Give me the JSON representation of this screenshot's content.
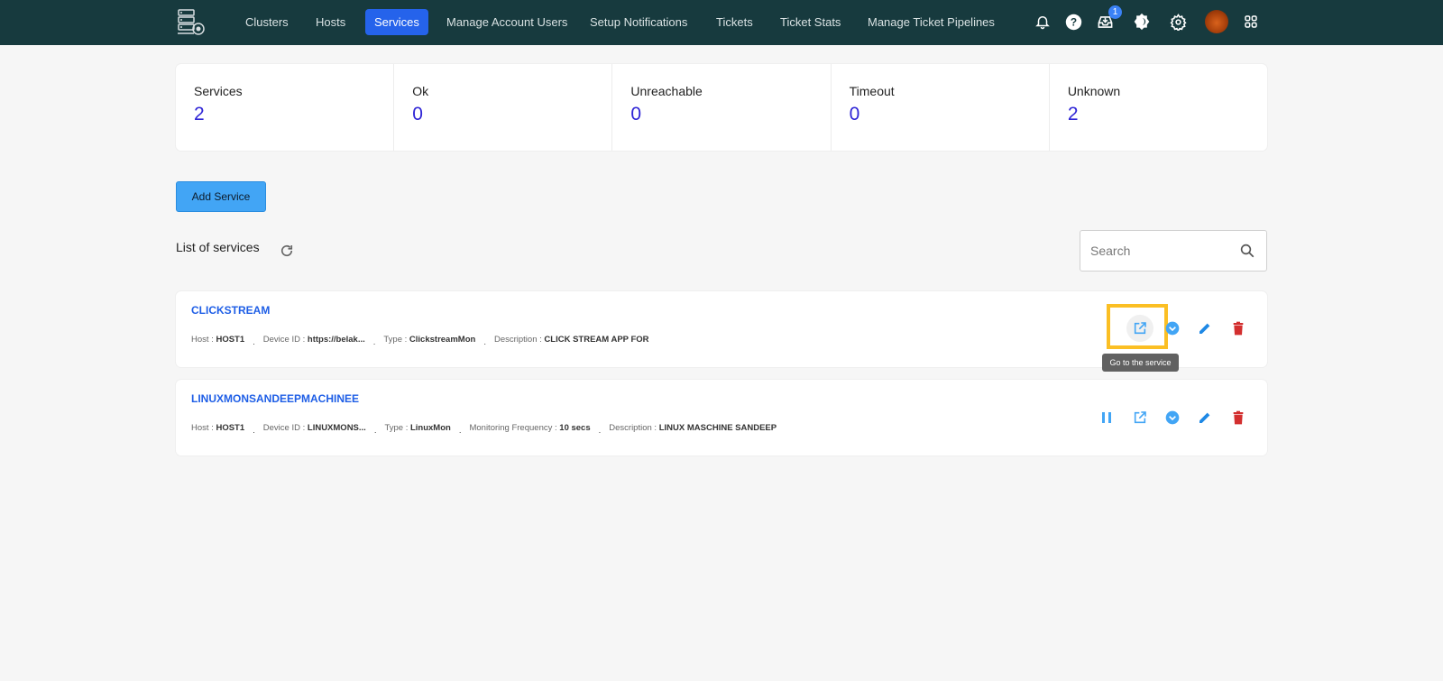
{
  "nav": {
    "items": [
      {
        "label": "Clusters",
        "active": false
      },
      {
        "label": "Hosts",
        "active": false
      },
      {
        "label": "Services",
        "active": true
      },
      {
        "label": "Manage Account Users",
        "active": false
      },
      {
        "label": "Setup Notifications",
        "active": false
      },
      {
        "label": "Tickets",
        "active": false
      },
      {
        "label": "Ticket Stats",
        "active": false
      },
      {
        "label": "Manage Ticket Pipelines",
        "active": false
      }
    ],
    "icons": [
      "bell-icon",
      "help-icon",
      "inbox-icon",
      "theme-toggle-icon",
      "settings-icon",
      "avatar",
      "apps-grid-icon"
    ],
    "inbox_badge": "1",
    "accent_color": "#2563eb",
    "bg_color": "#173a3e"
  },
  "stats": [
    {
      "label": "Services",
      "value": "2"
    },
    {
      "label": "Ok",
      "value": "0"
    },
    {
      "label": "Unreachable",
      "value": "0"
    },
    {
      "label": "Timeout",
      "value": "0"
    },
    {
      "label": "Unknown",
      "value": "2"
    }
  ],
  "add_service_label": "Add Service",
  "list_title": "List of services",
  "search": {
    "placeholder": "Search",
    "value": ""
  },
  "services": [
    {
      "name": "CLICKSTREAM",
      "fields": [
        {
          "label": "Host :",
          "value": "HOST1"
        },
        {
          "label": "Device ID :",
          "value": "https://belak..."
        },
        {
          "label": "Type :",
          "value": "ClickstreamMon"
        },
        {
          "label": "Description :",
          "value": "CLICK STREAM APP FOR"
        }
      ],
      "actions": [
        "open-service",
        "status-toggle",
        "edit",
        "delete"
      ]
    },
    {
      "name": "LINUXMONSANDEEPMACHINEE",
      "fields": [
        {
          "label": "Host :",
          "value": "HOST1"
        },
        {
          "label": "Device ID :",
          "value": "LINUXMONS..."
        },
        {
          "label": "Type :",
          "value": "LinuxMon"
        },
        {
          "label": "Monitoring Frequency :",
          "value": "10 secs"
        },
        {
          "label": "Description :",
          "value": "LINUX MASCHINE SANDEEP"
        }
      ],
      "actions": [
        "pause",
        "open-service",
        "status-toggle",
        "edit",
        "delete"
      ]
    }
  ],
  "tooltip": "Go to the service"
}
